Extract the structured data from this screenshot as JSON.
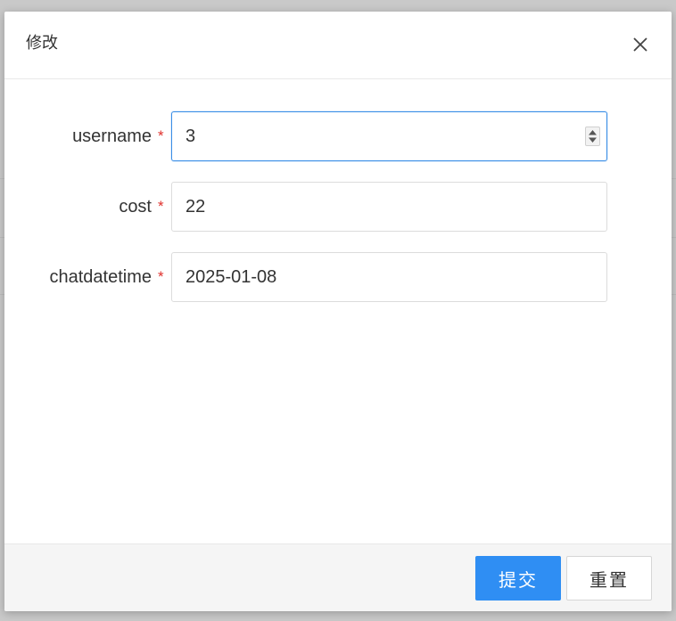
{
  "dialog": {
    "title": "修改",
    "close_icon": "close-icon"
  },
  "form": {
    "fields": [
      {
        "label": "username",
        "required": "*",
        "value": "3",
        "type": "number"
      },
      {
        "label": "cost",
        "required": "*",
        "value": "22",
        "type": "text"
      },
      {
        "label": "chatdatetime",
        "required": "*",
        "value": "2025-01-08",
        "type": "text"
      }
    ]
  },
  "footer": {
    "submit_label": "提交",
    "reset_label": "重置"
  },
  "colors": {
    "primary": "#2f8ef3",
    "required": "#e0312d",
    "focus_border": "#3a8ee6"
  }
}
